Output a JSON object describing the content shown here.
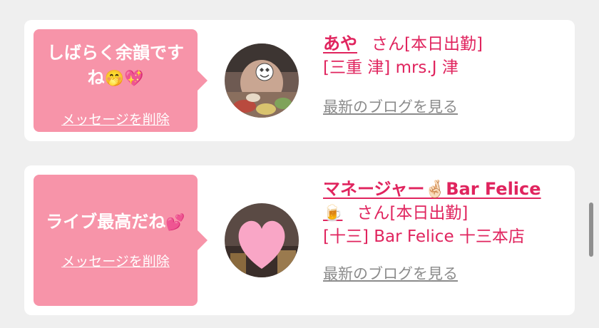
{
  "messages": [
    {
      "message": "しばらく余韻ですね",
      "emojis": "🤭💖",
      "delete_label": "メッセージを削除",
      "name": "あや",
      "suffix": "さん[本日出勤]",
      "location": "[三重 津] mrs.J 津",
      "blog_label": "最新のブログを見る"
    },
    {
      "message": "ライブ最高だね",
      "emojis": "💕",
      "delete_label": "メッセージを削除",
      "name": "マネージャー🤞🏻Bar Felice",
      "name_extra": "🍺",
      "suffix": "さん[本日出勤]",
      "location": "[十三] Bar Felice 十三本店",
      "blog_label": "最新のブログを見る"
    }
  ],
  "colors": {
    "bubble": "#f794a9",
    "accent": "#e0245e",
    "link_gray": "#8b8b8b",
    "background": "#efefef"
  },
  "icons": {
    "avatar_1": "photo-with-heart-eyes-sticker",
    "avatar_2": "photo-with-pink-heart-sticker"
  }
}
